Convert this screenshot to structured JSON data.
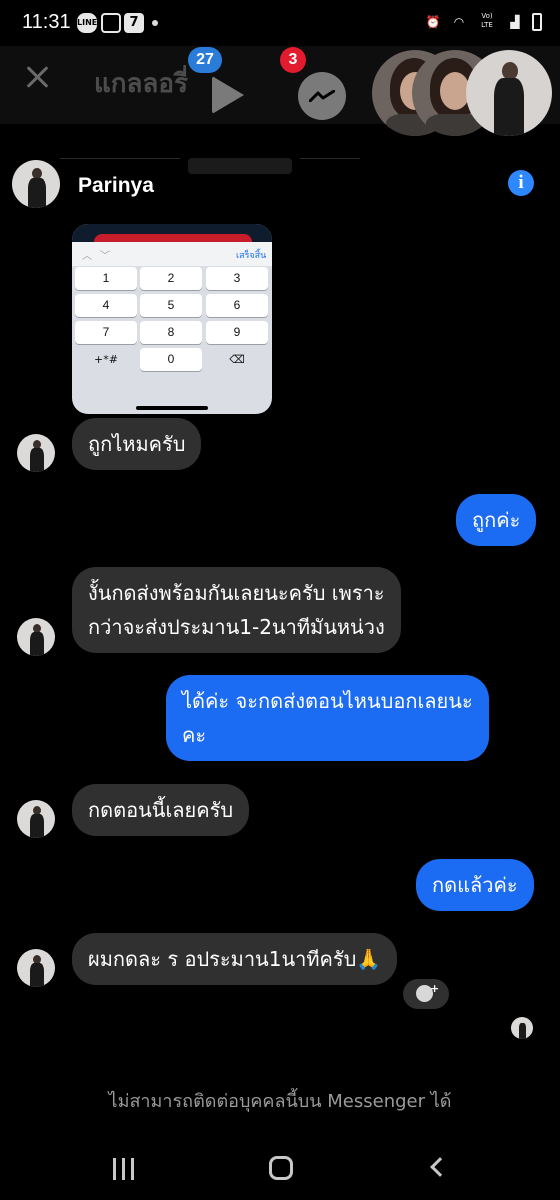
{
  "status_bar": {
    "time": "11:31",
    "icons_left": [
      "line-icon",
      "gallery-icon",
      "seven-eleven-icon",
      "dot-icon"
    ],
    "line_label": "LINE",
    "seven_label": "7",
    "icons_right": [
      "alarm-icon",
      "wifi-icon",
      "volte-icon",
      "signal-icon",
      "battery-icon"
    ],
    "volte_label": "Vo) LTE"
  },
  "top_header": {
    "title": "แกลลอรี่",
    "video_badge": "27",
    "messenger_badge": "3"
  },
  "chat": {
    "contact_name": "Parinya",
    "info_label": "i"
  },
  "shared_image": {
    "done_label": "เสร็จสิ้น",
    "keys": [
      "1",
      "2",
      "3",
      "4",
      "5",
      "6",
      "7",
      "8",
      "9",
      "+*#",
      "0",
      "⌫"
    ]
  },
  "messages": [
    {
      "direction": "received",
      "text": "ถูกไหมครับ"
    },
    {
      "direction": "sent",
      "text": "ถูกค่ะ"
    },
    {
      "direction": "received",
      "lines": [
        "งั้นกดส่งพร้อมกันเลยนะครับ เพราะ",
        "กว่าจะส่งประมาน1-2นาทีมันหน่วง"
      ]
    },
    {
      "direction": "sent",
      "lines": [
        "ได้ค่ะ จะกดส่งตอนไหนบอกเลยนะ",
        "คะ"
      ]
    },
    {
      "direction": "received",
      "text": "กดตอนนี้เลยครับ"
    },
    {
      "direction": "sent",
      "text": "กดแล้วค่ะ"
    },
    {
      "direction": "received",
      "text": "ผมกดละ ร อประมาน1นาทีครับ🙏"
    }
  ],
  "footer_notice": "ไม่สามารถติดต่อบุคคลนี้บน Messenger ได้",
  "colors": {
    "sent_bubble": "#1b6cf2",
    "received_bubble": "#303030",
    "background": "#000000",
    "badge_blue": "#2b7bd9",
    "badge_red": "#e21b2e",
    "info_blue": "#2d88ff"
  }
}
